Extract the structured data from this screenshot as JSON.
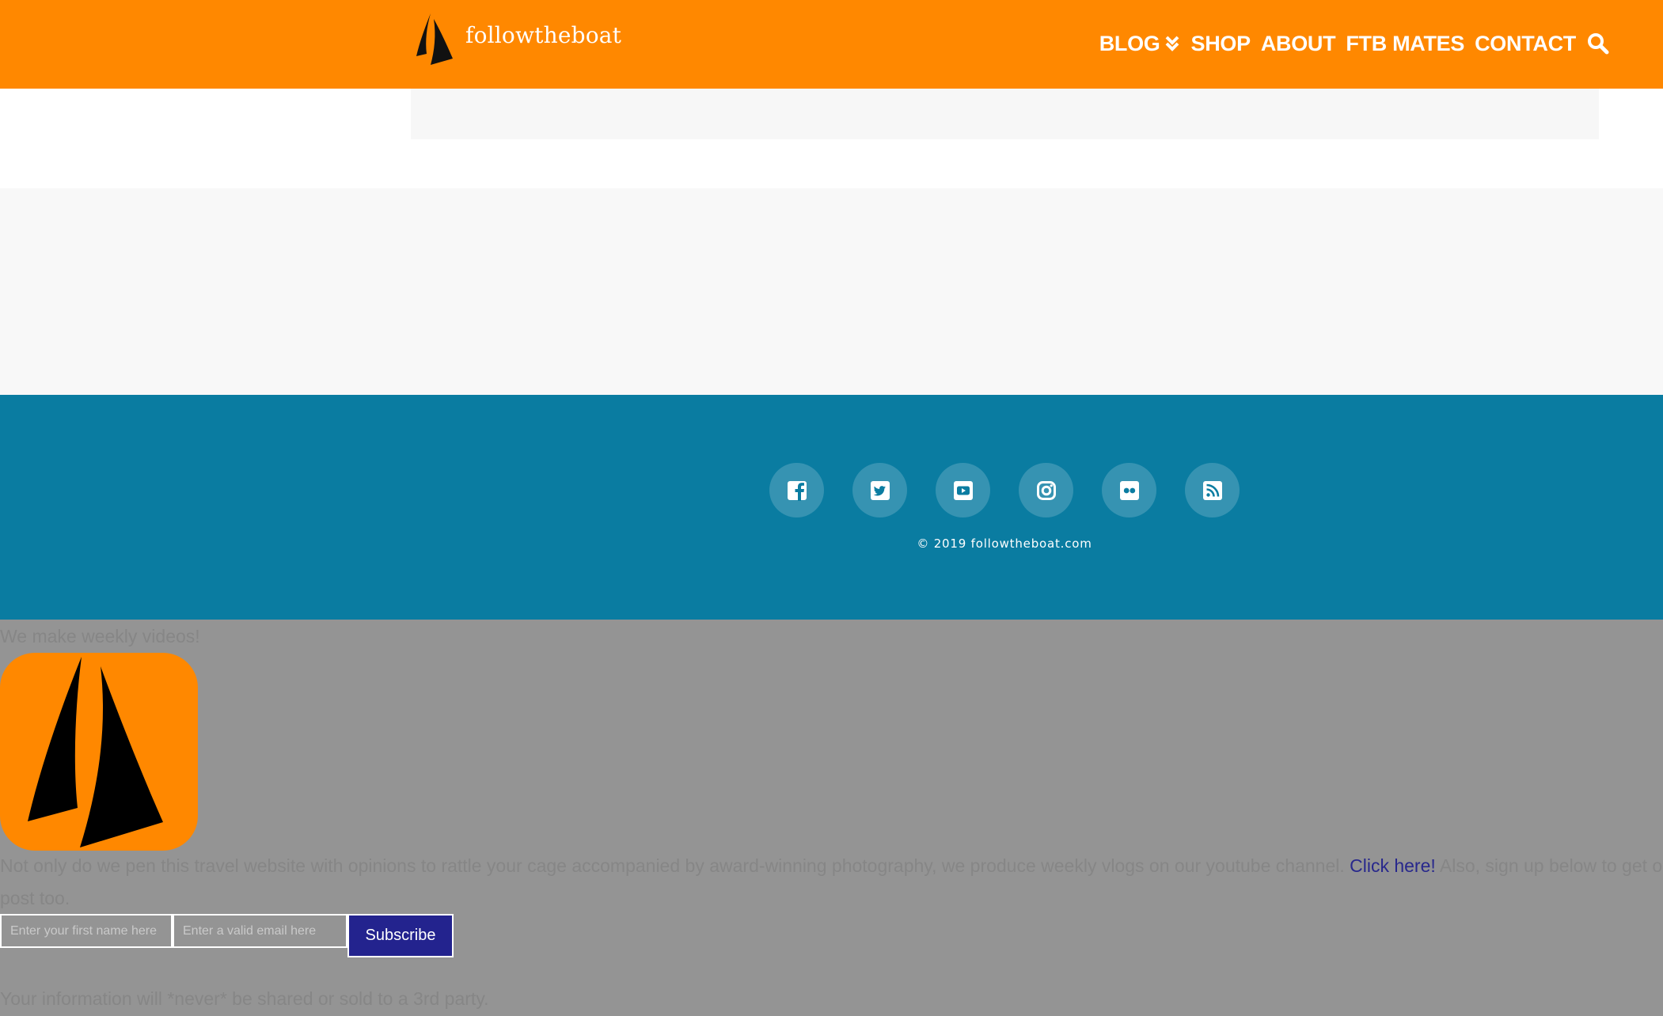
{
  "brand": {
    "name": "followtheboat",
    "accent_color": "#ff8800"
  },
  "nav": {
    "items": [
      {
        "label": "BLOG",
        "has_dropdown": true
      },
      {
        "label": "SHOP"
      },
      {
        "label": "ABOUT"
      },
      {
        "label": "FTB MATES"
      },
      {
        "label": "CONTACT"
      }
    ],
    "search_icon": "search-icon"
  },
  "footer": {
    "background_color": "#0a7ca1",
    "social": [
      {
        "icon": "facebook-icon"
      },
      {
        "icon": "twitter-icon"
      },
      {
        "icon": "youtube-icon"
      },
      {
        "icon": "instagram-icon"
      },
      {
        "icon": "flickr-icon"
      },
      {
        "icon": "rss-icon"
      }
    ],
    "copyright": "© 2019 followtheboat.com"
  },
  "popup": {
    "heading": "We make weekly videos!",
    "text_line1_before_link": "Not only do we pen this travel website with opinions to rattle your cage accompanied by award-winning photography, we produce weekly vlogs on our youtube channel. ",
    "link_text": "Click here!",
    "text_line1_after_link": " Also, sign up below to get our occasi",
    "text_line2": "post too.",
    "first_name_placeholder": "Enter your first name here",
    "email_placeholder": "Enter a valid email here",
    "subscribe_label": "Subscribe",
    "disclaimer": "Your information will *never* be shared or sold to a 3rd party."
  }
}
